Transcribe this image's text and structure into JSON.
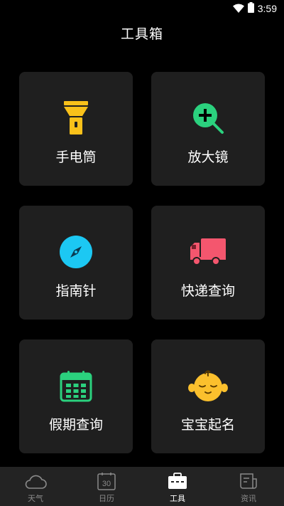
{
  "status_bar": {
    "time": "3:59",
    "wifi_icon": "wifi-icon",
    "battery_icon": "battery-icon"
  },
  "header": {
    "title": "工具箱"
  },
  "tools": [
    {
      "label": "手电筒",
      "icon": "flashlight-icon",
      "color": "#F9C11A"
    },
    {
      "label": "放大镜",
      "icon": "magnifier-icon",
      "color": "#2BD17E"
    },
    {
      "label": "指南针",
      "icon": "compass-icon",
      "color": "#1CC8F3"
    },
    {
      "label": "快递查询",
      "icon": "delivery-truck-icon",
      "color": "#F4566E"
    },
    {
      "label": "假期查询",
      "icon": "calendar-icon",
      "color": "#2BD17E"
    },
    {
      "label": "宝宝起名",
      "icon": "baby-face-icon",
      "color": "#FBC02D"
    }
  ],
  "bottom_nav": {
    "items": [
      {
        "label": "天气",
        "icon": "cloud-icon",
        "active": false
      },
      {
        "label": "日历",
        "icon": "calendar-date-icon",
        "icon_text": "30",
        "active": false
      },
      {
        "label": "工具",
        "icon": "toolbox-icon",
        "active": true
      },
      {
        "label": "资讯",
        "icon": "news-icon",
        "active": false
      }
    ]
  },
  "colors": {
    "background": "#000000",
    "card": "#1F1F1F",
    "nav_bg": "#232323",
    "nav_inactive": "#8A8A8A",
    "nav_active": "#FFFFFF"
  }
}
